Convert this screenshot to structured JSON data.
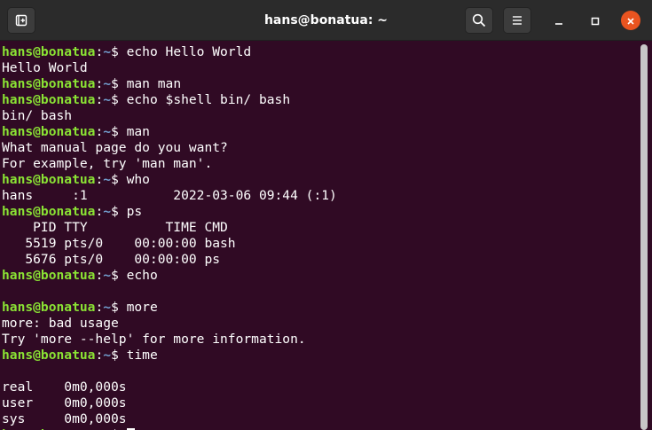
{
  "window": {
    "title": "hans@bonatua: ~"
  },
  "icons": {
    "new_tab": "new-tab-icon",
    "search": "search-icon",
    "menu": "hamburger-menu-icon",
    "minimize": "minimize-icon",
    "maximize": "maximize-icon",
    "close": "close-icon"
  },
  "colors": {
    "terminal_bg": "#300a24",
    "titlebar_bg": "#2b2b2b",
    "prompt_user": "#8ae234",
    "prompt_path": "#729fcf",
    "close_button": "#e95420"
  },
  "prompt": {
    "user_host": "hans@bonatua",
    "colon": ":",
    "path": "~",
    "symbol": "$ "
  },
  "lines": [
    {
      "kind": "cmd",
      "text": "echo Hello World"
    },
    {
      "kind": "out",
      "text": "Hello World"
    },
    {
      "kind": "cmd",
      "text": "man man"
    },
    {
      "kind": "cmd",
      "text": "echo $shell bin/ bash"
    },
    {
      "kind": "out",
      "text": "bin/ bash"
    },
    {
      "kind": "cmd",
      "text": "man"
    },
    {
      "kind": "out",
      "text": "What manual page do you want?"
    },
    {
      "kind": "out",
      "text": "For example, try 'man man'."
    },
    {
      "kind": "cmd",
      "text": "who"
    },
    {
      "kind": "out",
      "text": "hans     :1           2022-03-06 09:44 (:1)"
    },
    {
      "kind": "cmd",
      "text": "ps"
    },
    {
      "kind": "out",
      "text": "    PID TTY          TIME CMD"
    },
    {
      "kind": "out",
      "text": "   5519 pts/0    00:00:00 bash"
    },
    {
      "kind": "out",
      "text": "   5676 pts/0    00:00:00 ps"
    },
    {
      "kind": "cmd",
      "text": "echo"
    },
    {
      "kind": "out",
      "text": ""
    },
    {
      "kind": "cmd",
      "text": "more"
    },
    {
      "kind": "out",
      "text": "more: bad usage"
    },
    {
      "kind": "out",
      "text": "Try 'more --help' for more information."
    },
    {
      "kind": "cmd",
      "text": "time"
    },
    {
      "kind": "out",
      "text": ""
    },
    {
      "kind": "out",
      "text": "real    0m0,000s"
    },
    {
      "kind": "out",
      "text": "user    0m0,000s"
    },
    {
      "kind": "out",
      "text": "sys     0m0,000s"
    },
    {
      "kind": "cursor",
      "text": ""
    }
  ]
}
